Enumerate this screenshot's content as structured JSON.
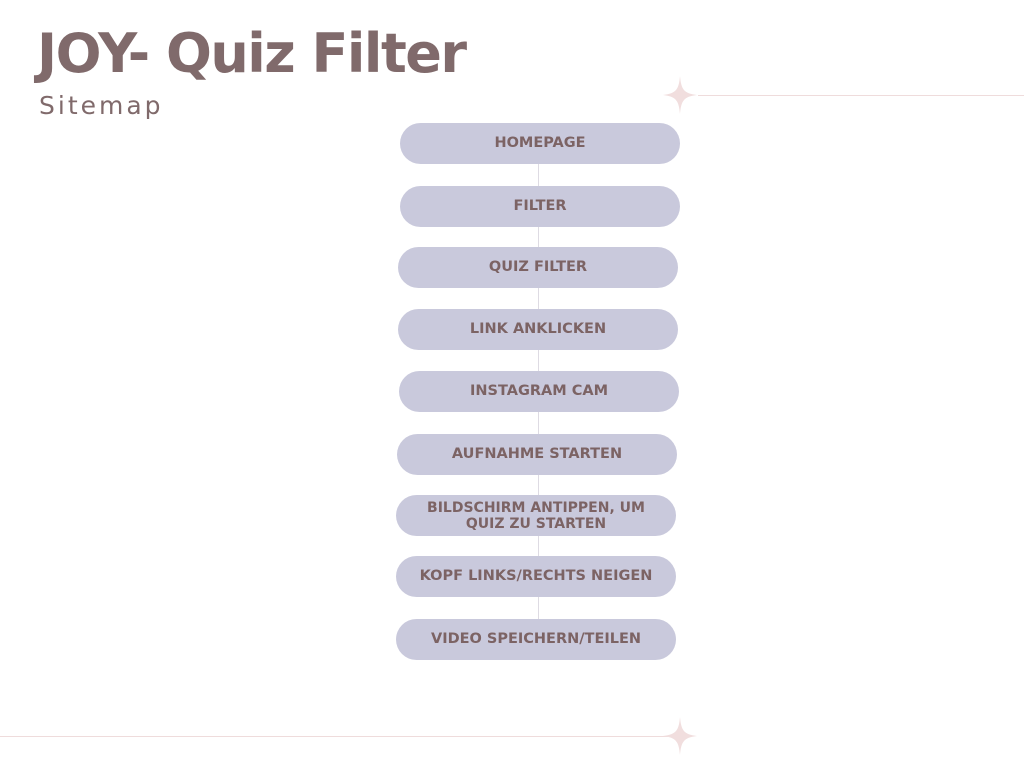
{
  "header": {
    "title": "JOY- Quiz Filter",
    "subtitle": "Sitemap"
  },
  "colors": {
    "title": "#806a6b",
    "node_fill": "#c9c9dc",
    "node_text": "#7c6364",
    "connector": "#dedbe3",
    "decoration": "#efdcdc"
  },
  "decorations": {
    "icon": "sparkle-icon"
  },
  "sitemap": {
    "nodes": [
      {
        "label": "HOMEPAGE"
      },
      {
        "label": "FILTER"
      },
      {
        "label": "QUIZ FILTER"
      },
      {
        "label": "LINK ANKLICKEN"
      },
      {
        "label": "INSTAGRAM CAM"
      },
      {
        "label": "AUFNAHME STARTEN"
      },
      {
        "label": "BILDSCHIRM ANTIPPEN, UM QUIZ ZU STARTEN"
      },
      {
        "label": "KOPF LINKS/RECHTS NEIGEN"
      },
      {
        "label": "VIDEO SPEICHERN/TEILEN"
      }
    ]
  }
}
